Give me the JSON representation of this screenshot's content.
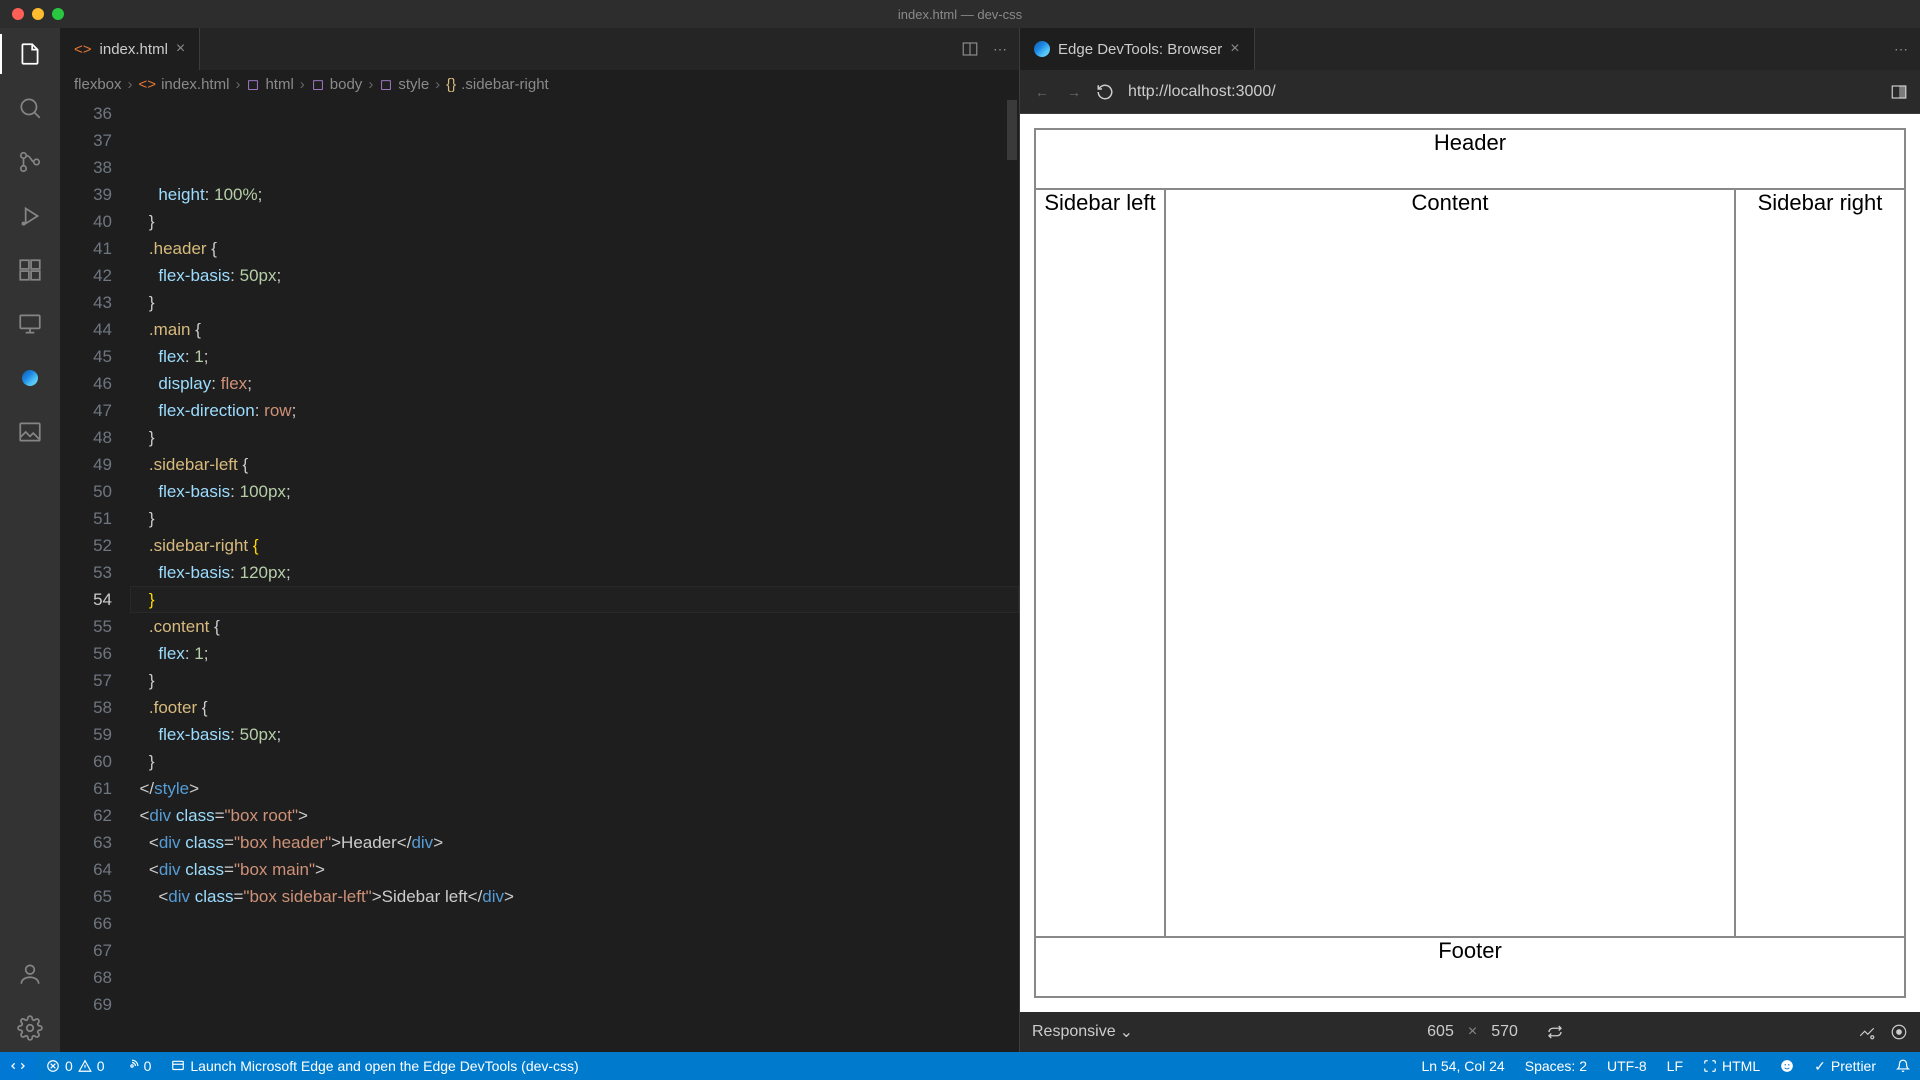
{
  "title": "index.html — dev-css",
  "activity": {
    "active": 0
  },
  "editor": {
    "tab_label": "index.html",
    "breadcrumbs": [
      "flexbox",
      "index.html",
      "html",
      "body",
      "style",
      ".sidebar-right"
    ],
    "actions_more": "⋯"
  },
  "code": {
    "first_line": 36,
    "current_line": 54,
    "lines": [
      {
        "n": 36,
        "ind": 3,
        "seg": [
          [
            "p",
            "height"
          ],
          [
            "",
            ": "
          ],
          [
            "v",
            "100%"
          ],
          [
            "",
            ";"
          ]
        ]
      },
      {
        "n": 37,
        "ind": 2,
        "seg": [
          [
            "",
            "}"
          ]
        ]
      },
      {
        "n": 38,
        "ind": 0,
        "seg": [
          [
            "",
            ""
          ]
        ]
      },
      {
        "n": 39,
        "ind": 2,
        "seg": [
          [
            "s",
            ".header"
          ],
          [
            "",
            " {"
          ]
        ]
      },
      {
        "n": 40,
        "ind": 3,
        "seg": [
          [
            "p",
            "flex-basis"
          ],
          [
            "",
            ": "
          ],
          [
            "v",
            "50px"
          ],
          [
            "",
            ";"
          ]
        ]
      },
      {
        "n": 41,
        "ind": 2,
        "seg": [
          [
            "",
            "}"
          ]
        ]
      },
      {
        "n": 42,
        "ind": 0,
        "seg": [
          [
            "",
            ""
          ]
        ]
      },
      {
        "n": 43,
        "ind": 2,
        "seg": [
          [
            "s",
            ".main"
          ],
          [
            "",
            " {"
          ]
        ]
      },
      {
        "n": 44,
        "ind": 3,
        "seg": [
          [
            "p",
            "flex"
          ],
          [
            "",
            ": "
          ],
          [
            "v",
            "1"
          ],
          [
            "",
            ";"
          ]
        ]
      },
      {
        "n": 45,
        "ind": 3,
        "seg": [
          [
            "p",
            "display"
          ],
          [
            "",
            ": "
          ],
          [
            "kw",
            "flex"
          ],
          [
            "",
            ";"
          ]
        ]
      },
      {
        "n": 46,
        "ind": 3,
        "seg": [
          [
            "p",
            "flex-direction"
          ],
          [
            "",
            ": "
          ],
          [
            "kw",
            "row"
          ],
          [
            "",
            ";"
          ]
        ]
      },
      {
        "n": 47,
        "ind": 2,
        "seg": [
          [
            "",
            "}"
          ]
        ]
      },
      {
        "n": 48,
        "ind": 0,
        "seg": [
          [
            "",
            ""
          ]
        ]
      },
      {
        "n": 49,
        "ind": 2,
        "seg": [
          [
            "s",
            ".sidebar-left"
          ],
          [
            "",
            " {"
          ]
        ]
      },
      {
        "n": 50,
        "ind": 3,
        "seg": [
          [
            "p",
            "flex-basis"
          ],
          [
            "",
            ": "
          ],
          [
            "v",
            "100px"
          ],
          [
            "",
            ";"
          ]
        ]
      },
      {
        "n": 51,
        "ind": 2,
        "seg": [
          [
            "",
            "}"
          ]
        ]
      },
      {
        "n": 52,
        "ind": 0,
        "seg": [
          [
            "",
            ""
          ]
        ]
      },
      {
        "n": 53,
        "ind": 2,
        "seg": [
          [
            "s",
            ".sidebar-right"
          ],
          [
            "",
            " "
          ],
          [
            "br",
            "{"
          ]
        ]
      },
      {
        "n": 54,
        "ind": 3,
        "seg": [
          [
            "p",
            "flex-basis"
          ],
          [
            "",
            ": "
          ],
          [
            "v",
            "120px"
          ],
          [
            "",
            ";"
          ]
        ]
      },
      {
        "n": 55,
        "ind": 2,
        "seg": [
          [
            "br",
            "}"
          ]
        ]
      },
      {
        "n": 56,
        "ind": 0,
        "seg": [
          [
            "",
            ""
          ]
        ]
      },
      {
        "n": 57,
        "ind": 2,
        "seg": [
          [
            "s",
            ".content"
          ],
          [
            "",
            " {"
          ]
        ]
      },
      {
        "n": 58,
        "ind": 3,
        "seg": [
          [
            "p",
            "flex"
          ],
          [
            "",
            ": "
          ],
          [
            "v",
            "1"
          ],
          [
            "",
            ";"
          ]
        ]
      },
      {
        "n": 59,
        "ind": 2,
        "seg": [
          [
            "",
            "}"
          ]
        ]
      },
      {
        "n": 60,
        "ind": 0,
        "seg": [
          [
            "",
            ""
          ]
        ]
      },
      {
        "n": 61,
        "ind": 2,
        "seg": [
          [
            "s",
            ".footer"
          ],
          [
            "",
            " {"
          ]
        ]
      },
      {
        "n": 62,
        "ind": 3,
        "seg": [
          [
            "p",
            "flex-basis"
          ],
          [
            "",
            ": "
          ],
          [
            "v",
            "50px"
          ],
          [
            "",
            ";"
          ]
        ]
      },
      {
        "n": 63,
        "ind": 2,
        "seg": [
          [
            "",
            "}"
          ]
        ]
      },
      {
        "n": 64,
        "ind": 1,
        "seg": [
          [
            "",
            "</"
          ],
          [
            "t",
            "style"
          ],
          [
            "",
            ">"
          ]
        ]
      },
      {
        "n": 65,
        "ind": 0,
        "seg": [
          [
            "",
            ""
          ]
        ]
      },
      {
        "n": 66,
        "ind": 1,
        "seg": [
          [
            "",
            "<"
          ],
          [
            "t",
            "div"
          ],
          [
            "",
            " "
          ],
          [
            "a",
            "class"
          ],
          [
            "",
            "="
          ],
          [
            "str",
            "\"box root\""
          ],
          [
            "",
            ">"
          ]
        ]
      },
      {
        "n": 67,
        "ind": 2,
        "seg": [
          [
            "",
            "<"
          ],
          [
            "t",
            "div"
          ],
          [
            "",
            " "
          ],
          [
            "a",
            "class"
          ],
          [
            "",
            "="
          ],
          [
            "str",
            "\"box header\""
          ],
          [
            "",
            ">"
          ],
          [
            "",
            "Header"
          ],
          [
            "",
            "</"
          ],
          [
            "t",
            "div"
          ],
          [
            "",
            ">"
          ]
        ]
      },
      {
        "n": 68,
        "ind": 2,
        "seg": [
          [
            "",
            "<"
          ],
          [
            "t",
            "div"
          ],
          [
            "",
            " "
          ],
          [
            "a",
            "class"
          ],
          [
            "",
            "="
          ],
          [
            "str",
            "\"box main\""
          ],
          [
            "",
            ">"
          ]
        ]
      },
      {
        "n": 69,
        "ind": 3,
        "seg": [
          [
            "",
            "<"
          ],
          [
            "t",
            "div"
          ],
          [
            "",
            " "
          ],
          [
            "a",
            "class"
          ],
          [
            "",
            "="
          ],
          [
            "str",
            "\"box sidebar-left\""
          ],
          [
            "",
            ">"
          ],
          [
            "",
            "Sidebar left"
          ],
          [
            "",
            "</"
          ],
          [
            "t",
            "div"
          ],
          [
            "",
            ">"
          ]
        ]
      }
    ]
  },
  "devtools": {
    "tab_label": "Edge DevTools: Browser",
    "url": "http://localhost:3000/",
    "device_mode": "Responsive",
    "width": "605",
    "height": "570"
  },
  "preview": {
    "header": "Header",
    "sidebar_left": "Sidebar left",
    "content": "Content",
    "sidebar_right": "Sidebar right",
    "footer": "Footer"
  },
  "status": {
    "errors": "0",
    "warnings": "0",
    "ports": "0",
    "launch": "Launch Microsoft Edge and open the Edge DevTools (dev-css)",
    "cursor": "Ln 54, Col 24",
    "spaces": "Spaces: 2",
    "encoding": "UTF-8",
    "eol": "LF",
    "language": "HTML",
    "prettier": "Prettier"
  }
}
